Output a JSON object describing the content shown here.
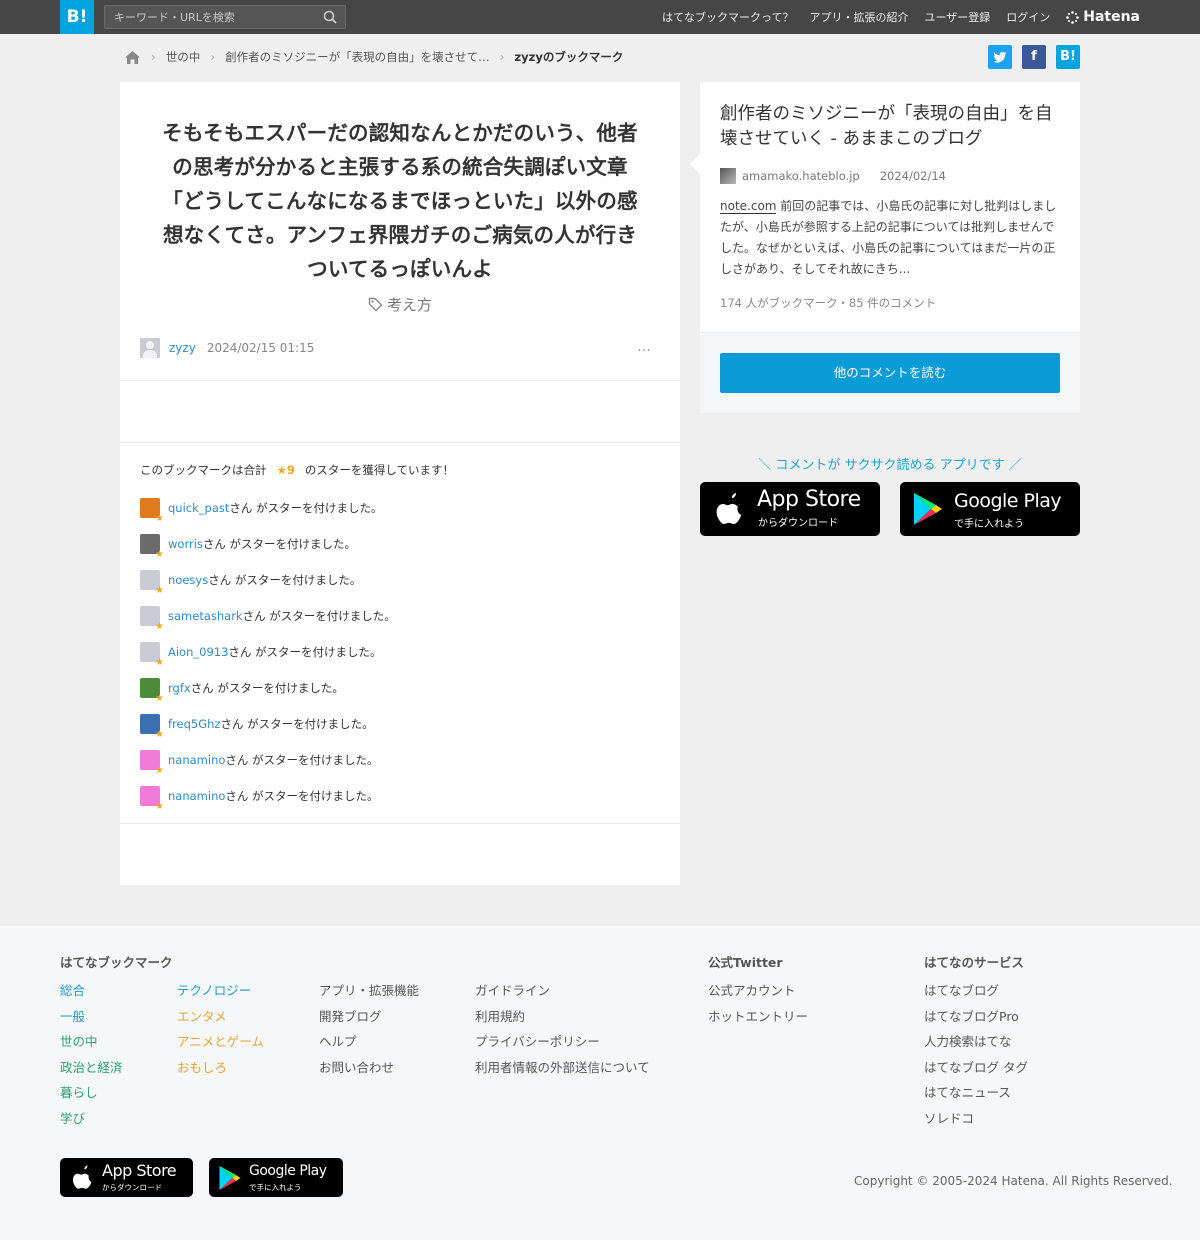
{
  "header": {
    "logo": "B!",
    "search_placeholder": "キーワード・URLを検索",
    "nav": [
      "はてなブックマークって？",
      "アプリ・拡張の紹介",
      "ユーザー登録",
      "ログイン"
    ],
    "brand": "Hatena"
  },
  "breadcrumb": {
    "items": [
      "世の中",
      "創作者のミソジニーが「表現の自由」を壊させて…",
      "zyzyのブックマーク"
    ]
  },
  "share": {
    "facebook": "f",
    "hatena": "B!"
  },
  "bookmark": {
    "comment": "そもそもエスパーだの認知なんとかだのいう、他者の思考が分かると主張する系の統合失調ぽい文章「どうしてこんなになるまでほっといた」以外の感想なくてさ。アンフェ界隈ガチのご病気の人が行きついてるっぽいんよ",
    "tag": "考え方",
    "user": "zyzy",
    "datetime": "2024/02/15 01:15",
    "menu": "…"
  },
  "stars": {
    "prefix": "このブックマークは合計",
    "star_glyph": "★",
    "count": "9",
    "suffix": "のスターを獲得しています！",
    "action_text": "さん がスターを付けました。",
    "users": [
      {
        "name": "quick_past",
        "color": "#e07a1f"
      },
      {
        "name": "worris",
        "color": "#6b6b6b"
      },
      {
        "name": "noesys",
        "color": "#c9ccd4"
      },
      {
        "name": "sametashark",
        "color": "#c9ccd4"
      },
      {
        "name": "Aion_0913",
        "color": "#c9ccd4"
      },
      {
        "name": "rgfx",
        "color": "#4a8a3a"
      },
      {
        "name": "freq5Ghz",
        "color": "#3a6fb0"
      },
      {
        "name": "nanamino",
        "color": "#f07ad8"
      },
      {
        "name": "nanamino",
        "color": "#f07ad8"
      }
    ]
  },
  "entry": {
    "title": "創作者のミソジニーが「表現の自由」を自壊させていく - あままこのブログ",
    "domain": "amamako.hateblo.jp",
    "date": "2024/02/14",
    "summary_link": "note.com",
    "summary": " 前回の記事では、小島氏の記事に対し批判はしましたが、小島氏が参照する上記の記事については批判しませんでした。なぜかといえば、小島氏の記事についてはまだ一片の正しさがあり、そしてそれ故にきち...",
    "counts": "174 人がブックマーク・85 件のコメント",
    "button": "他のコメントを読む"
  },
  "promo": {
    "text": "＼ コメントが サクサク読める アプリです ／",
    "appstore_big": "App Store",
    "appstore_small": "からダウンロード",
    "googleplay_big": "Google Play",
    "googleplay_small": "で手に入れよう"
  },
  "footer": {
    "heading_bookmark": "はてなブックマーク",
    "col_blue": [
      "総合",
      "一般"
    ],
    "col_green": [
      "世の中",
      "政治と経済",
      "暮らし",
      "学び"
    ],
    "col_blue2": [
      "テクノロジー"
    ],
    "col_orange": [
      "エンタメ",
      "アニメとゲーム",
      "おもしろ"
    ],
    "col_misc": [
      "アプリ・拡張機能",
      "開発ブログ",
      "ヘルプ",
      "お問い合わせ"
    ],
    "col_misc2": [
      "ガイドライン",
      "利用規約",
      "プライバシーポリシー",
      "利用者情報の外部送信について"
    ],
    "heading_twitter": "公式Twitter",
    "col_twitter": [
      "公式アカウント",
      "ホットエントリー"
    ],
    "heading_services": "はてなのサービス",
    "col_services": [
      "はてなブログ",
      "はてなブログPro",
      "人力検索はてな",
      "はてなブログ タグ",
      "はてなニュース",
      "ソレドコ"
    ],
    "copyright": "Copyright © 2005-2024 Hatena. All Rights Reserved."
  }
}
